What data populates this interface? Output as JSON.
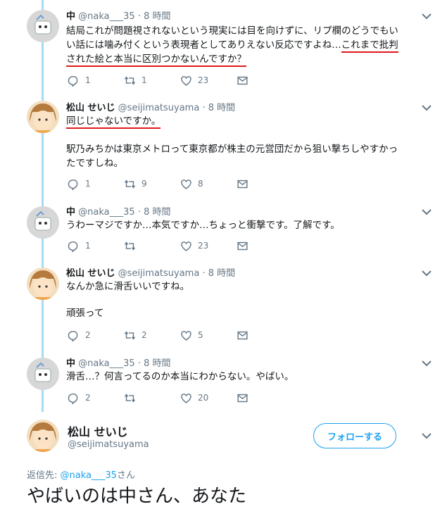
{
  "tweets": [
    {
      "name": "中",
      "handle": "@naka___35",
      "time": "· 8 時間",
      "avatar": "naka",
      "lines": [
        "結局これが問題視されないという現実には目を向けずに、リプ欄のどうでもい",
        "い話には噛み付くという表現者としてありえない反応ですよね…",
        "これまで批判",
        "された絵と本当に区別つかないんですか？"
      ],
      "counts": {
        "reply": "1",
        "retweet": "1",
        "like": "23"
      }
    },
    {
      "name": "松山 せいじ",
      "handle": "@seijimatsuyama",
      "time": "· 8 時間",
      "avatar": "matsuyama",
      "underlined": "同じじゃないですか。",
      "lines": [
        "駅乃みちかは東京メトロって東京都が株主の元営団だから狙い撃ちしやすかっ",
        "たですしね。"
      ],
      "counts": {
        "reply": "1",
        "retweet": "9",
        "like": "8"
      }
    },
    {
      "name": "中",
      "handle": "@naka___35",
      "time": "· 8 時間",
      "avatar": "naka",
      "lines": [
        "うわーマジですか…本気ですか…ちょっと衝撃です。了解です。"
      ],
      "counts": {
        "reply": "1",
        "retweet": "",
        "like": "23"
      }
    },
    {
      "name": "松山 せいじ",
      "handle": "@seijimatsuyama",
      "time": "· 8 時間",
      "avatar": "matsuyama",
      "lines": [
        "なんか急に滑舌いいですね。",
        "頑張って"
      ],
      "counts": {
        "reply": "2",
        "retweet": "2",
        "like": "5"
      }
    },
    {
      "name": "中",
      "handle": "@naka___35",
      "time": "· 8 時間",
      "avatar": "naka",
      "lines": [
        "滑舌…？何言ってるのか本当にわからない。やばい。"
      ],
      "counts": {
        "reply": "2",
        "retweet": "",
        "like": "20"
      }
    }
  ],
  "main_tweet": {
    "name": "松山 せいじ",
    "handle": "@seijimatsuyama",
    "follow_label": "フォローする",
    "reply_to_prefix": "返信先: ",
    "reply_to_handle": "@naka___35",
    "reply_to_suffix": "さん",
    "text": "やばいのは中さん、あなた"
  },
  "colors": {
    "accent": "#1da1f2",
    "thread_line": "#a6daf9",
    "underline": "#e0191b",
    "muted": "#657786"
  }
}
